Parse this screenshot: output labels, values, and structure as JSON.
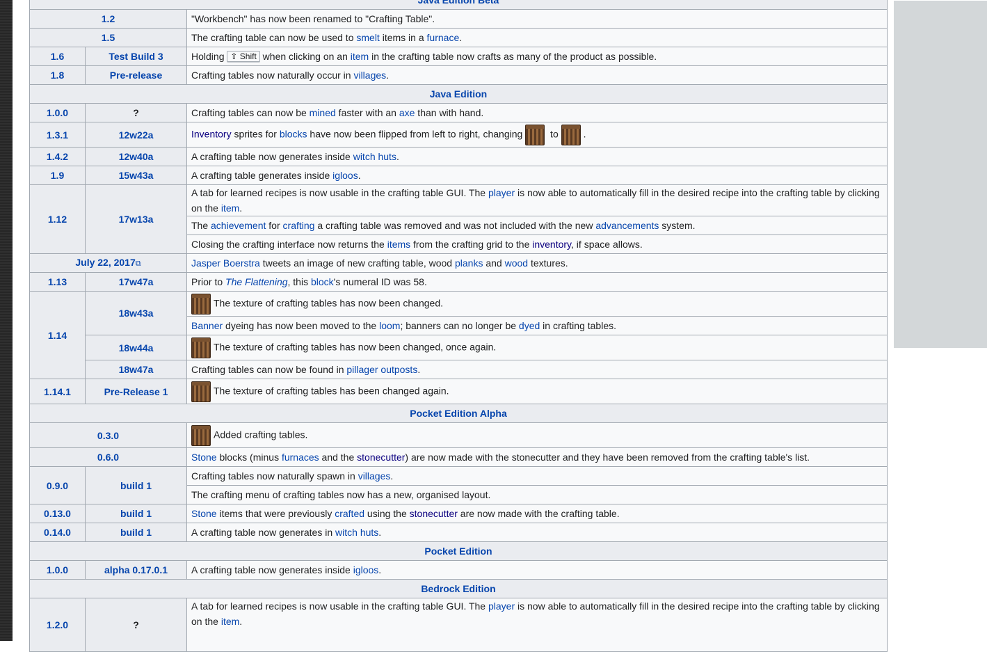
{
  "headers": {
    "java_edition_beta": "Java Edition Beta",
    "java_edition": "Java Edition",
    "pocket_edition_alpha": "Pocket Edition Alpha",
    "pocket_edition": "Pocket Edition",
    "bedrock_edition": "Bedrock Edition"
  },
  "rows": {
    "b12": {
      "version": "1.2",
      "t1": "\"Workbench\" has now been renamed to \"Crafting Table\"."
    },
    "b15": {
      "version": "1.5",
      "t1": "The crafting table can now be used to ",
      "l1": "smelt",
      "t2": " items in a ",
      "l2": "furnace",
      "t3": "."
    },
    "b16": {
      "version": "1.6",
      "build": "Test Build 3",
      "t1": "Holding ",
      "kbd": "⇧ Shift",
      "t2": " when clicking on an ",
      "l1": "item",
      "t3": " in the crafting table now crafts as many of the product as possible."
    },
    "b18": {
      "version": "1.8",
      "build": "Pre-release",
      "t1": "Crafting tables now naturally occur in ",
      "l1": "villages",
      "t2": "."
    },
    "j100": {
      "version": "1.0.0",
      "build": "?",
      "t1": "Crafting tables can now be ",
      "l1": "mined",
      "t2": " faster with an ",
      "l2": "axe",
      "t3": " than with hand."
    },
    "j131": {
      "version": "1.3.1",
      "build": "12w22a",
      "l1": "Inventory",
      "t1": " sprites for ",
      "l2": "blocks",
      "t2": " have now been flipped from left to right, changing ",
      "t3": " to ",
      "t4": "."
    },
    "j142": {
      "version": "1.4.2",
      "build": "12w40a",
      "t1": "A crafting table now generates inside ",
      "l1": "witch huts",
      "t2": "."
    },
    "j19": {
      "version": "1.9",
      "build": "15w43a",
      "t1": "A crafting table generates inside ",
      "l1": "igloos",
      "t2": "."
    },
    "j112": {
      "version": "1.12",
      "build": "17w13a",
      "a_t1": "A tab for learned recipes is now usable in the crafting table GUI. The ",
      "a_l1": "player",
      "a_t2": " is now able to automatically fill in the desired recipe into the crafting table by clicking on the ",
      "a_l2": "item",
      "a_t3": ".",
      "b_t1": "The ",
      "b_l1": "achievement",
      "b_t2": " for ",
      "b_l2": "crafting",
      "b_t3": " a crafting table was removed and was not included with the new ",
      "b_l3": "advancements",
      "b_t4": " system.",
      "c_t1": "Closing the crafting interface now returns the ",
      "c_l1": "items",
      "c_t2": " from the crafting grid to the ",
      "c_l2": "inventory",
      "c_t3": ", if space allows."
    },
    "jdate": {
      "version": "July 22, 2017",
      "l1": "Jasper Boerstra",
      "t1": " tweets an image of new crafting table, wood ",
      "l2": "planks",
      "t2": " and ",
      "l3": "wood",
      "t3": " textures."
    },
    "j113": {
      "version": "1.13",
      "build": "17w47a",
      "t1": "Prior to ",
      "l1": "The Flattening",
      "t2": ", this ",
      "l2": "block",
      "t3": "'s numeral ID was 58."
    },
    "j114": {
      "version": "1.14",
      "build1": "18w43a",
      "a_t1": "The texture of crafting tables has now been changed.",
      "b_l1": "Banner",
      "b_t1": " dyeing has now been moved to the ",
      "b_l2": "loom",
      "b_t2": "; banners can no longer be ",
      "b_l3": "dyed",
      "b_t3": " in crafting tables.",
      "build2": "18w44a",
      "c_t1": "The texture of crafting tables has now been changed, once again.",
      "build3": "18w47a",
      "d_t1": "Crafting tables can now be found in ",
      "d_l1": "pillager outposts",
      "d_t2": "."
    },
    "j1141": {
      "version": "1.14.1",
      "build": "Pre-Release 1",
      "t1": "The texture of crafting tables has been changed again."
    },
    "p030": {
      "version": "0.3.0",
      "t1": "Added crafting tables."
    },
    "p060": {
      "version": "0.6.0",
      "l1": "Stone",
      "t1": " blocks (minus ",
      "l2": "furnaces",
      "t2": " and the ",
      "l3": "stonecutter",
      "t3": ") are now made with the stonecutter and they have been removed from the crafting table's list."
    },
    "p090": {
      "version": "0.9.0",
      "build": "build 1",
      "a_t1": "Crafting tables now naturally spawn in ",
      "a_l1": "villages",
      "a_t2": ".",
      "b_t1": "The crafting menu of crafting tables now has a new, organised layout."
    },
    "p0130": {
      "version": "0.13.0",
      "build": "build 1",
      "l1": "Stone",
      "t1": " items that were previously ",
      "l2": "crafted",
      "t2": " using the ",
      "l3": "stonecutter",
      "t3": " are now made with the crafting table."
    },
    "p0140": {
      "version": "0.14.0",
      "build": "build 1",
      "t1": "A crafting table now generates in ",
      "l1": "witch huts",
      "t2": "."
    },
    "pe100": {
      "version": "1.0.0",
      "build": "alpha 0.17.0.1",
      "t1": "A crafting table now generates inside ",
      "l1": "igloos",
      "t2": "."
    },
    "be120": {
      "version": "1.2.0",
      "build": "?",
      "t1": "A tab for learned recipes is now usable in the crafting table GUI. The ",
      "l1": "player",
      "t2": " is now able to automatically fill in the desired recipe into the crafting table by clicking on the ",
      "l2": "item",
      "t3": "."
    }
  }
}
